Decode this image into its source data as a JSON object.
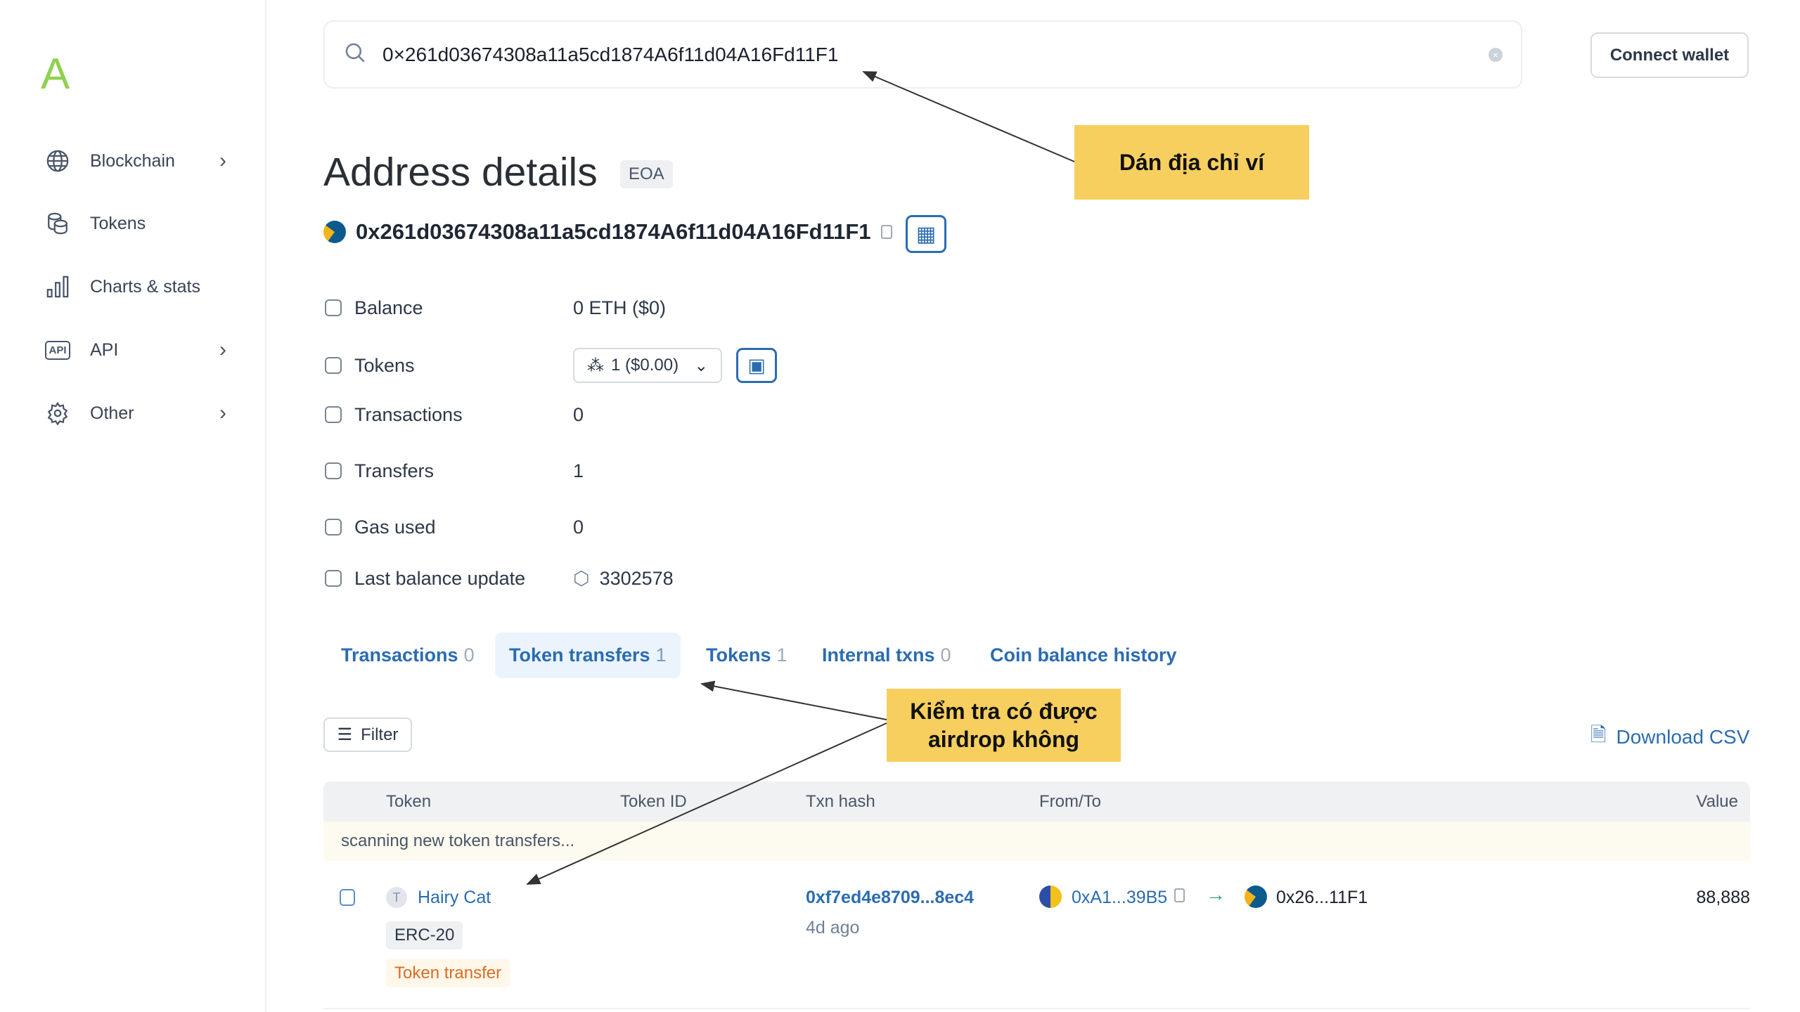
{
  "sidebar": {
    "logo": "A",
    "items": [
      {
        "label": "Blockchain",
        "icon": "globe-icon",
        "has_submenu": true
      },
      {
        "label": "Tokens",
        "icon": "coins-icon",
        "has_submenu": false
      },
      {
        "label": "Charts & stats",
        "icon": "bar-chart-icon",
        "has_submenu": false
      },
      {
        "label": "API",
        "icon": "api-icon",
        "has_submenu": true
      },
      {
        "label": "Other",
        "icon": "gear-icon",
        "has_submenu": true
      }
    ]
  },
  "header": {
    "search_value": "0×261d03674308a11a5cd1874A6f11d04A16Fd11F1",
    "connect_wallet": "Connect wallet"
  },
  "page": {
    "title": "Address details",
    "badge": "EOA",
    "address": "0x261d03674308a11a5cd1874A6f11d04A16Fd11F1"
  },
  "details": {
    "balance_label": "Balance",
    "balance": "0 ETH ($0)",
    "tokens_label": "Tokens",
    "tokens": "1 ($0.00)",
    "transactions_label": "Transactions",
    "transactions": "0",
    "transfers_label": "Transfers",
    "transfers": "1",
    "gas_label": "Gas used",
    "gas": "0",
    "last_update_label": "Last balance update",
    "last_update": "3302578"
  },
  "tabs": [
    {
      "label": "Transactions",
      "count": "0"
    },
    {
      "label": "Token transfers",
      "count": "1",
      "active": true
    },
    {
      "label": "Tokens",
      "count": "1"
    },
    {
      "label": "Internal txns",
      "count": "0"
    },
    {
      "label": "Coin balance history",
      "count": ""
    }
  ],
  "toolbar": {
    "filter": "Filter",
    "download": "Download CSV"
  },
  "table": {
    "headers": [
      "Token",
      "Token ID",
      "Txn hash",
      "From/To",
      "Value"
    ],
    "scanning": "scanning new token transfers...",
    "rows": [
      {
        "token_initial": "T",
        "token": "Hairy Cat",
        "standard": "ERC-20",
        "type": "Token transfer",
        "txn_hash": "0xf7ed4e8709...8ec4",
        "age": "4d ago",
        "from": "0xA1...39B5",
        "to": "0x26...11F1",
        "value": "88,888"
      }
    ]
  },
  "annotations": {
    "paste": "Dán địa chỉ ví",
    "check": "Kiểm tra có được airdrop không"
  },
  "colors": {
    "accent": "#2b6cb0",
    "annotation": "#f7cf5e",
    "logo": "#8fd14f"
  }
}
